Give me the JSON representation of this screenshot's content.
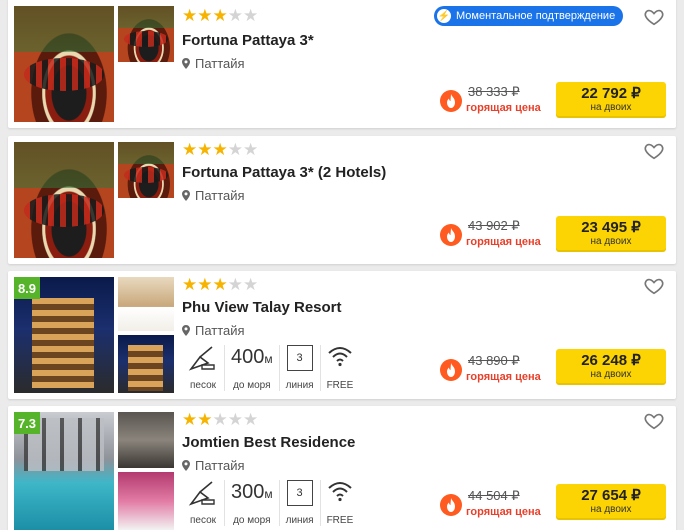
{
  "common": {
    "location": "Паттайя",
    "hot_label": "горящая цена",
    "price_sub": "на двоих",
    "instant_badge": "Моментальное подтверждение",
    "feature_labels": {
      "beach": "песок",
      "distance": "до моря",
      "line": "линия",
      "wifi": "FREE"
    },
    "distance_unit": "м"
  },
  "colors": {
    "star": "#f6b400",
    "accent_blue": "#1a73e8",
    "hot": "#e8402a",
    "price_button": "#fcd403",
    "rating_badge": "#55b42a"
  },
  "hotels": [
    {
      "name": "Fortuna Pattaya 3*",
      "stars": 3,
      "old_price": "38 333 ₽",
      "price": "22 792 ₽",
      "instant": true
    },
    {
      "name": "Fortuna Pattaya 3* (2 Hotels)",
      "stars": 3,
      "old_price": "43 902 ₽",
      "price": "23 495 ₽",
      "instant": false
    },
    {
      "name": "Phu View Talay Resort",
      "stars": 3,
      "rating": "8.9",
      "old_price": "43 890 ₽",
      "price": "26 248 ₽",
      "distance": "400",
      "line": "3"
    },
    {
      "name": "Jomtien Best Residence",
      "stars": 2,
      "rating": "7.3",
      "old_price": "44 504 ₽",
      "price": "27 654 ₽",
      "distance": "300",
      "line": "3"
    }
  ]
}
